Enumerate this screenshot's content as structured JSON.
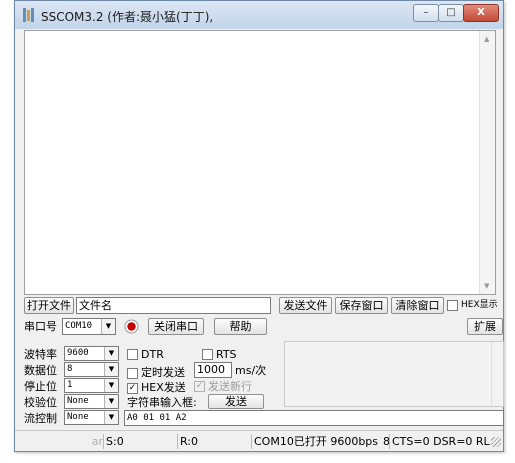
{
  "window": {
    "title": "SSCOM3.2 (作者:聂小猛(丁丁),"
  },
  "controls": {
    "minimize": "–",
    "maximize": "□",
    "close": "X"
  },
  "row1": {
    "open_file_button": "打开文件",
    "filename_value": "文件名",
    "send_file_button": "发送文件",
    "save_window_button": "保存窗口",
    "clear_window_button": "清除窗口",
    "hex_display_label": "HEX显示"
  },
  "row2": {
    "port_label": "串口号",
    "port_value": "COM10",
    "close_port_button": "关闭串口",
    "help_button": "帮助",
    "expand_button": "扩展"
  },
  "params": [
    {
      "label": "波特率",
      "value": "9600"
    },
    {
      "label": "数据位",
      "value": "8"
    },
    {
      "label": "停止位",
      "value": "1"
    },
    {
      "label": "校验位",
      "value": "None"
    },
    {
      "label": "流控制",
      "value": "None"
    }
  ],
  "options": {
    "dtr_label": "DTR",
    "rts_label": "RTS",
    "timed_send_label": "定时发送",
    "interval_value": "1000",
    "interval_unit": "ms/次",
    "hex_send_label": "HEX发送",
    "hex_send_checked": "✓",
    "newline_send_label": "发送新行",
    "input_label": "字符串输入框:",
    "send_button": "发送",
    "input_value": "A0 01 01 A2"
  },
  "status": {
    "edge": "ar",
    "sent": "S:0",
    "received": "R:0",
    "port_state": "COM10已打开  9600bps",
    "mid_fragment": "8",
    "signals": "CTS=0 DSR=0 RL"
  },
  "colors": {
    "port_indicator": "#c00000",
    "titlebar_top": "#dbe6f3"
  }
}
